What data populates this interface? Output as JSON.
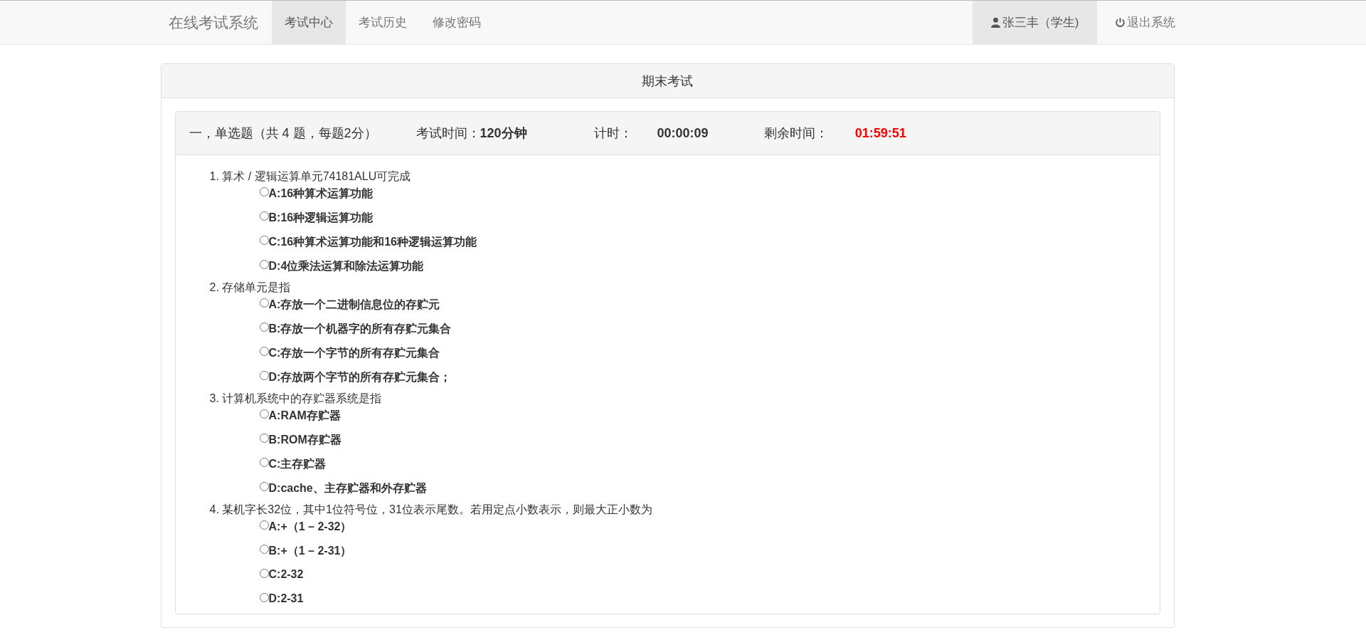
{
  "navbar": {
    "brand": "在线考试系统",
    "tabs": [
      {
        "label": "考试中心",
        "selected": true
      },
      {
        "label": "考试历史",
        "selected": false
      },
      {
        "label": "修改密码",
        "selected": false
      }
    ],
    "user_menu": [
      {
        "kind": "user",
        "label": "张三丰（学生)",
        "selected": true
      },
      {
        "kind": "logout",
        "label": "退出系统",
        "selected": false
      }
    ]
  },
  "exam": {
    "title": "期末考试",
    "section": {
      "heading": "一，单选题（共 4 题，每题2分）",
      "duration_label": "考试时间：",
      "duration": "120分钟",
      "elapsed_label": "计时：",
      "elapsed": "00:00:09",
      "remaining_label": "剩余时间：",
      "remaining": "01:59:51"
    },
    "questions": [
      {
        "text": "1. 算术 / 逻辑运算单元74181ALU可完成",
        "options": [
          {
            "label": "A:16种算术运算功能",
            "selected": false
          },
          {
            "label": "B:16种逻辑运算功能",
            "selected": false
          },
          {
            "label": "C:16种算术运算功能和16种逻辑运算功能",
            "selected": false
          },
          {
            "label": "D:4位乘法运算和除法运算功能",
            "selected": false
          }
        ]
      },
      {
        "text": "2. 存储单元是指",
        "options": [
          {
            "label": "A:存放一个二进制信息位的存贮元",
            "selected": false
          },
          {
            "label": "B:存放一个机器字的所有存贮元集合",
            "selected": false
          },
          {
            "label": "C:存放一个字节的所有存贮元集合",
            "selected": false
          },
          {
            "label": "D:存放两个字节的所有存贮元集合；",
            "selected": false
          }
        ]
      },
      {
        "text": "3. 计算机系统中的存贮器系统是指",
        "options": [
          {
            "label": "A:RAM存贮器",
            "selected": false
          },
          {
            "label": "B:ROM存贮器",
            "selected": false
          },
          {
            "label": "C:主存贮器",
            "selected": false
          },
          {
            "label": "D:cache、主存贮器和外存贮器",
            "selected": false
          }
        ]
      },
      {
        "text": "4. 某机字长32位，其中1位符号位，31位表示尾数。若用定点小数表示，则最大正小数为",
        "options": [
          {
            "label": "A:+（1 – 2-32）",
            "selected": false
          },
          {
            "label": "B:+（1 – 2-31）",
            "selected": false
          },
          {
            "label": "C:2-32",
            "selected": false
          },
          {
            "label": "D:2-31",
            "selected": false
          }
        ]
      }
    ]
  }
}
